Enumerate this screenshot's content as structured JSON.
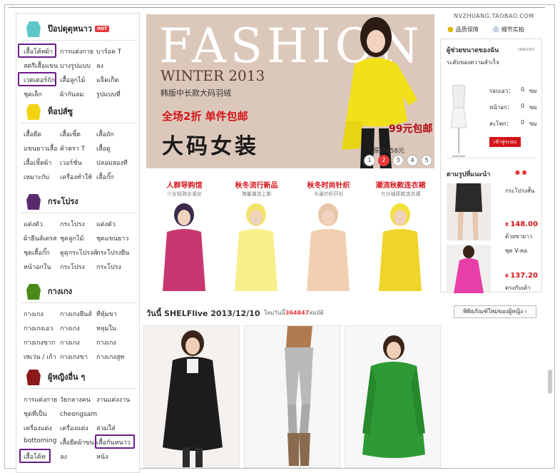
{
  "shop": {
    "name": "NVZHUANG.TAOBAO.COM",
    "tab_quality": "品质保障",
    "tab_detail": "细节实拍"
  },
  "sidebar": {
    "categories": [
      {
        "title": "ป๊อปดุดุหนาว",
        "hot": "HOT",
        "icon": "coat-icon",
        "links": [
          [
            "เสื้อโค้ทผ้า",
            "การแต่งกาย",
            "บาร์อค T"
          ],
          [
            "สตรีเสื้อแขน",
            "บางรูปแบบ",
            "ลง"
          ],
          [
            "เวตเตอร์ถัก",
            "เสื้อลูกไม้",
            "แจ็คเก็ต"
          ],
          [
            "ชุดเล็ก",
            "ผ้ากันลม",
            "รูปแบบที่"
          ]
        ]
      },
      {
        "title": "ท็อปส์ซู",
        "icon": "top-icon",
        "links": [
          [
            "เสื้อยืด",
            "เสื้อเชิ้ต",
            "เสื้อถัก"
          ],
          [
            "แขนยาวเสื้อ",
            "ค้าตรา T",
            "เสื้อดู"
          ],
          [
            "เสื้อเชิ้ตผ้า",
            "เวอร์ชั่น",
            "ปลอมสองที"
          ],
          [
            "เหมาะกับ",
            "เครื่องทำให้",
            "เสื้อกั๊ก"
          ]
        ]
      },
      {
        "title": "กระโปรง",
        "icon": "skirt-icon",
        "links": [
          [
            "แต่งตัว",
            "กระโปรง",
            "แต่งตัว"
          ],
          [
            "ผ้ายีนส์เดรส",
            "ชุดลูกไม้",
            "ชุดแขนยาว"
          ],
          [
            "ชุดเสื้อกั๊ก",
            "ดูดุกระโปรงค้า",
            "กระโปรงยีน"
          ],
          [
            "หน้าอกใน",
            "กระโปรง",
            "กระโปรง"
          ]
        ]
      },
      {
        "title": "กางเกง",
        "icon": "pants-icon",
        "links": [
          [
            "กางเกง",
            "กางเกงยีนส์",
            "ที่หุ้มขา"
          ],
          [
            "กางเกงเอว",
            "กางเกง",
            "หลุมใน"
          ],
          [
            "กางเกงขาก",
            "กางเกง",
            "กางเกง"
          ],
          [
            "เซเว่น / เก้า",
            "กางเกงขา",
            "กางเกงสูท"
          ]
        ]
      },
      {
        "title": "ผู้หญิงอื่น ๆ",
        "icon": "dress-icon",
        "links": [
          [
            "การแต่งกาย",
            "วัยกลางคน",
            "งานแต่งงาน"
          ],
          [
            "ชุดที่เป็น",
            "cheongsamในห้องลับ",
            ""
          ],
          [
            "เครื่องแต่ง",
            "เครื่องแต่ง",
            "สวมใส่"
          ],
          [
            "bottoming",
            "เสื้อยืดผ้าขน",
            "เสื้อกันหนาว"
          ],
          [
            "เสื้อโค้ท",
            "ลง",
            "หนัง"
          ]
        ]
      }
    ]
  },
  "banner": {
    "headline": "FASHION",
    "season": "WINTER 2013",
    "subtitle": "韩版中长款大码羽绒",
    "offer": "全场2折 单件包邮",
    "big": "大码女装",
    "price": "99元包邮",
    "orig_price": "原价658元",
    "slides": [
      "1",
      "2",
      "3",
      "4",
      "5"
    ],
    "active_slide": 2
  },
  "promos": [
    {
      "title": "人群导购馆",
      "sub": "少女轻熟女淑女"
    },
    {
      "title": "秋冬流行新品",
      "sub": "海量潮流上新"
    },
    {
      "title": "秋冬时尚针织",
      "sub": "卡通针织开衫"
    },
    {
      "title": "潮流秋款连衣裙",
      "sub": "七分袖厚款连衣裙"
    }
  ],
  "shelf": {
    "title": "วันนี้ SHELFlive 2013/12/10",
    "sub_label": "ใหม่วันนี้",
    "count": "364847",
    "sub_suffix": "สมบัติ",
    "button": "พิพิธภัณฑ์ใหม่ของผู้หญิง"
  },
  "size_helper": {
    "title": "ผู้ช่วยขนาดของฉัน",
    "title_badge": "เผยแพร่",
    "subtitle": "ระดับของความสำเร็จ",
    "fields": [
      {
        "label": "รอบเอว：",
        "value": "0",
        "unit": "ซม"
      },
      {
        "label": "หน้าอก：",
        "value": "0",
        "unit": "ซม"
      },
      {
        "label": "สะโพก：",
        "value": "0",
        "unit": "ซม"
      }
    ],
    "button": "เข้าสู่ระบบ"
  },
  "recommend": {
    "title": "ตามรูปที่แนะนำ",
    "items": [
      {
        "name": "กระโปรงสั้น",
        "price": "148.00",
        "note": "ด้วยขายาว"
      },
      {
        "name": "ชุด V-คอ",
        "price": "137.20",
        "note": "ตรงกับเต้า"
      }
    ]
  },
  "colors": {
    "accent": "#d4141a",
    "highlight": "#6a1b8a",
    "banner_bg": "#dcc8bb"
  }
}
